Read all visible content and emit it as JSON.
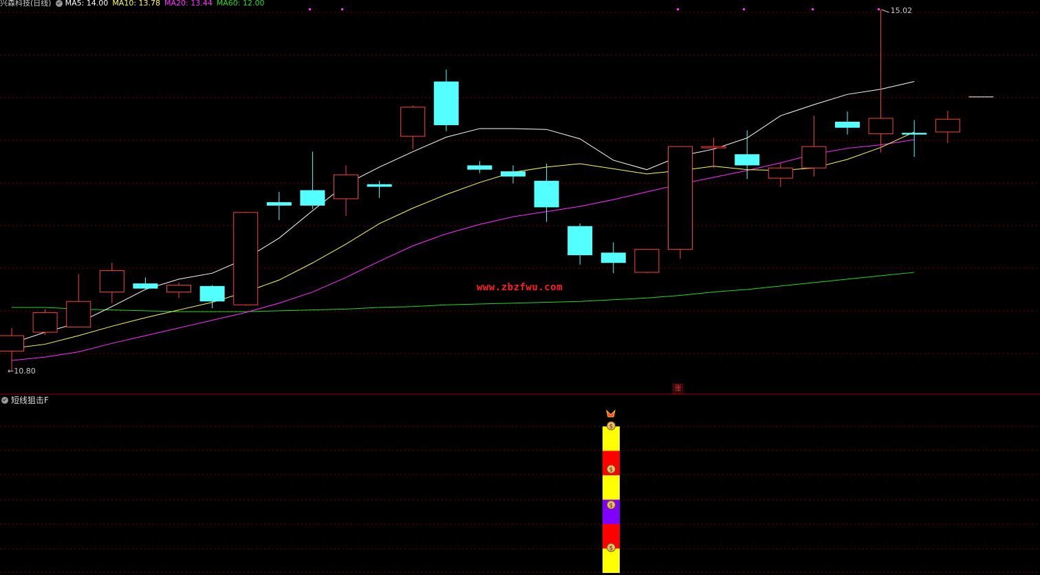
{
  "header": {
    "stock_name": "兴森科技(日线)",
    "ma5": "MA5: 14.00",
    "ma10": "MA10: 13.78",
    "ma20": "MA20: 13.44",
    "ma60": "MA60: 12.00"
  },
  "subpanel": {
    "title": "短线狙击F"
  },
  "watermark": "www.zbzfwu.com",
  "marker_label": "涨",
  "colors": {
    "up": "#ff4040",
    "down": "#54ffff",
    "ma5": "#ffffff",
    "ma10": "#ffff55",
    "ma20": "#ff30ff",
    "ma60": "#20dd20",
    "grid": "#7a0000"
  },
  "chart_data": {
    "type": "candlestick",
    "max_label": "15.02",
    "min_label": "10.80",
    "candles": [
      {
        "o": 11.03,
        "h": 11.3,
        "l": 10.8,
        "c": 11.21
      },
      {
        "o": 11.25,
        "h": 11.52,
        "l": 11.22,
        "c": 11.48
      },
      {
        "o": 11.31,
        "h": 11.93,
        "l": 11.32,
        "c": 11.61
      },
      {
        "o": 11.72,
        "h": 12.06,
        "l": 11.59,
        "c": 11.97
      },
      {
        "o": 11.82,
        "h": 11.89,
        "l": 11.75,
        "c": 11.76
      },
      {
        "o": 11.72,
        "h": 11.83,
        "l": 11.65,
        "c": 11.8
      },
      {
        "o": 11.79,
        "h": 11.8,
        "l": 11.53,
        "c": 11.61
      },
      {
        "o": 11.57,
        "h": 12.66,
        "l": 11.56,
        "c": 12.65
      },
      {
        "o": 12.77,
        "h": 12.89,
        "l": 12.56,
        "c": 12.73
      },
      {
        "o": 12.91,
        "h": 13.36,
        "l": 12.69,
        "c": 12.73
      },
      {
        "o": 12.81,
        "h": 13.2,
        "l": 12.61,
        "c": 13.09
      },
      {
        "o": 12.98,
        "h": 13.02,
        "l": 12.82,
        "c": 12.95
      },
      {
        "o": 13.54,
        "h": 13.9,
        "l": 13.39,
        "c": 13.88
      },
      {
        "o": 14.18,
        "h": 14.32,
        "l": 13.6,
        "c": 13.67
      },
      {
        "o": 13.2,
        "h": 13.25,
        "l": 13.11,
        "c": 13.15
      },
      {
        "o": 13.13,
        "h": 13.2,
        "l": 12.99,
        "c": 13.07
      },
      {
        "o": 13.02,
        "h": 13.22,
        "l": 12.54,
        "c": 12.71
      },
      {
        "o": 12.49,
        "h": 12.52,
        "l": 12.04,
        "c": 12.15
      },
      {
        "o": 12.18,
        "h": 12.3,
        "l": 11.94,
        "c": 12.06
      },
      {
        "o": 11.95,
        "h": 12.22,
        "l": 11.94,
        "c": 12.22
      },
      {
        "o": 12.22,
        "h": 13.42,
        "l": 12.11,
        "c": 13.42
      },
      {
        "o": 13.42,
        "h": 13.52,
        "l": 13.17,
        "c": 13.42
      },
      {
        "o": 13.33,
        "h": 13.61,
        "l": 13.04,
        "c": 13.2
      },
      {
        "o": 13.05,
        "h": 13.23,
        "l": 12.95,
        "c": 13.17
      },
      {
        "o": 13.17,
        "h": 13.78,
        "l": 13.07,
        "c": 13.42
      },
      {
        "o": 13.71,
        "h": 13.83,
        "l": 13.56,
        "c": 13.64
      },
      {
        "o": 13.57,
        "h": 15.02,
        "l": 13.35,
        "c": 13.75
      },
      {
        "o": 13.58,
        "h": 13.73,
        "l": 13.3,
        "c": 13.56
      },
      {
        "o": 13.59,
        "h": 13.84,
        "l": 13.46,
        "c": 13.74
      },
      {
        "o": 14.0,
        "h": 14.0,
        "l": 14.0,
        "c": 14.0
      }
    ],
    "ma5": [
      11.12,
      11.25,
      11.36,
      11.55,
      11.75,
      11.87,
      11.94,
      12.11,
      12.35,
      12.67,
      12.98,
      13.18,
      13.36,
      13.53,
      13.63,
      13.63,
      13.62,
      13.51,
      13.26,
      13.15,
      13.31,
      13.39,
      13.52,
      13.78,
      13.91,
      14.03,
      14.09,
      14.18
    ],
    "ma10": [
      11.06,
      11.11,
      11.21,
      11.32,
      11.42,
      11.51,
      11.6,
      11.72,
      11.86,
      12.06,
      12.28,
      12.52,
      12.7,
      12.86,
      13.0,
      13.12,
      13.18,
      13.22,
      13.16,
      13.1,
      13.14,
      13.19,
      13.15,
      13.14,
      13.17,
      13.27,
      13.41,
      13.59
    ],
    "ma20": [
      10.92,
      10.96,
      11.02,
      11.12,
      11.21,
      11.3,
      11.39,
      11.48,
      11.59,
      11.72,
      11.89,
      12.08,
      12.26,
      12.4,
      12.51,
      12.6,
      12.66,
      12.72,
      12.8,
      12.89,
      12.98,
      13.06,
      13.14,
      13.23,
      13.33,
      13.4,
      13.44,
      13.5
    ],
    "ma60": [
      11.54,
      11.54,
      11.52,
      11.51,
      11.5,
      11.49,
      11.49,
      11.49,
      11.5,
      11.51,
      11.52,
      11.54,
      11.55,
      11.57,
      11.58,
      11.59,
      11.6,
      11.61,
      11.63,
      11.65,
      11.68,
      11.72,
      11.75,
      11.79,
      11.83,
      11.87,
      11.91,
      11.95
    ],
    "indicator_blocks": [
      "yellow",
      "red",
      "yellow",
      "purple",
      "red",
      "yellow"
    ]
  }
}
